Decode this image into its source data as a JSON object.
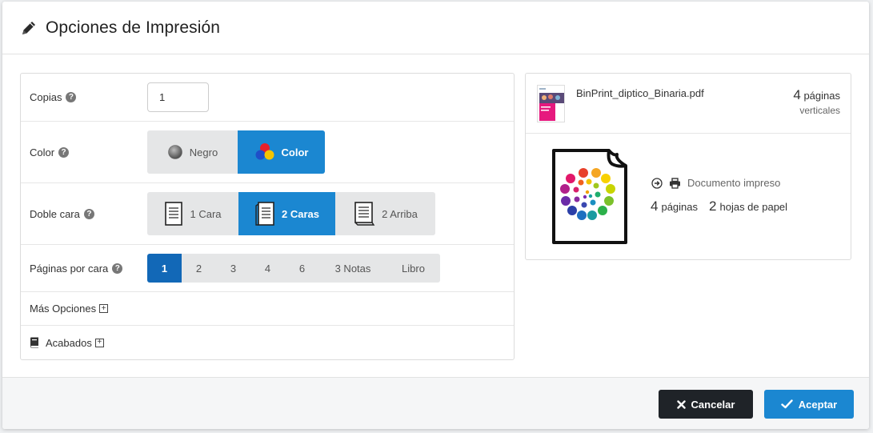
{
  "dialog": {
    "title": "Opciones de Impresión"
  },
  "options": {
    "copies": {
      "label": "Copias",
      "value": "1"
    },
    "color": {
      "label": "Color",
      "choices": [
        "Negro",
        "Color"
      ],
      "selected": "Color"
    },
    "duplex": {
      "label": "Doble cara",
      "choices": [
        "1 Cara",
        "2 Caras",
        "2 Arriba"
      ],
      "selected": "2 Caras"
    },
    "pages_per_side": {
      "label": "Páginas por cara",
      "choices": [
        "1",
        "2",
        "3",
        "4",
        "6",
        "3 Notas",
        "Libro"
      ],
      "selected": "1"
    },
    "more_options": {
      "label": "Más Opciones"
    },
    "finishes": {
      "label": "Acabados"
    }
  },
  "file": {
    "name": "BinPrint_diptico_Binaria.pdf",
    "pages_count": "4",
    "pages_label": "páginas",
    "orientation": "verticales"
  },
  "summary": {
    "status": "Documento impreso",
    "pages_count": "4",
    "pages_label": "páginas",
    "sheets_count": "2",
    "sheets_label": "hojas de papel"
  },
  "footer": {
    "cancel_label": "Cancelar",
    "accept_label": "Aceptar"
  },
  "colors": {
    "accent": "#1b87d1",
    "accent_dark": "#1268b7",
    "dark_button": "#1f2328"
  }
}
